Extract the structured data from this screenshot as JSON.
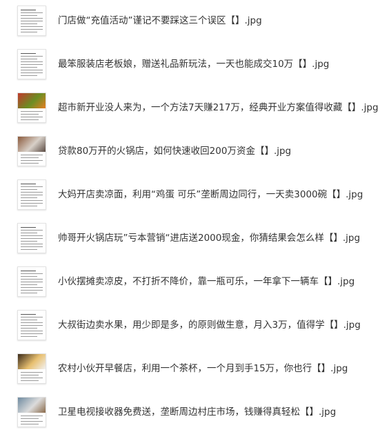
{
  "files": [
    {
      "name": "门店做“充值活动”谨记不要踩这三个误区【】.jpg",
      "thumb": "doc-text"
    },
    {
      "name": "最笨服装店老板娘，赠送礼品新玩法，一天也能成交10万【】.jpg",
      "thumb": "doc-text"
    },
    {
      "name": "超市新开业没人来为，一个方法7天赚217万，经典开业方案值得收藏【】.jpg",
      "thumb": "photo-produce"
    },
    {
      "name": "贷款80万开的火锅店，如何快速收回200万资金【】.jpg",
      "thumb": "photo-restaurant"
    },
    {
      "name": "大妈开店卖凉面，利用“鸡蛋 可乐”垄断周边同行，一天卖3000碗【】.jpg",
      "thumb": "doc-text"
    },
    {
      "name": "帅哥开火锅店玩”亏本营销“进店送2000现金，你猜结果会怎么样【】.jpg",
      "thumb": "doc-text"
    },
    {
      "name": "小伙摆摊卖凉皮，不打折不降价，靠一瓶可乐，一年拿下一辆车【】.jpg",
      "thumb": "doc-text"
    },
    {
      "name": "大叔街边卖水果，用少即是多，的原则做生意，月入3万，值得学【】.jpg",
      "thumb": "doc-text"
    },
    {
      "name": "农村小伙开早餐店，利用一个茶杯，一个月到手15万，你也行【】.jpg",
      "thumb": "photo-food"
    },
    {
      "name": "卫星电视接收器免费送，垄断周边村庄市场，钱赚得真轻松【】.jpg",
      "thumb": "photo-dish"
    }
  ],
  "thumb_colors": {
    "photo-produce": [
      "#c0392b",
      "#6b8e23",
      "#e67e22"
    ],
    "photo-restaurant": [
      "#8b5a3c",
      "#d8d0c8",
      "#5a4a42"
    ],
    "photo-food": [
      "#3a2a1a",
      "#e8c070",
      "#f2f2f2"
    ],
    "photo-dish": [
      "#6e8aa0",
      "#dcdcdc",
      "#8a6a4a"
    ]
  }
}
